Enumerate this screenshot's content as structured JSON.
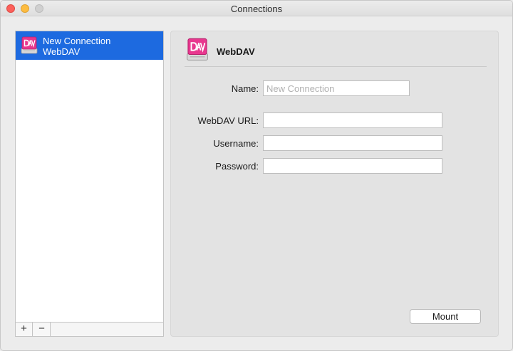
{
  "window": {
    "title": "Connections"
  },
  "sidebar": {
    "items": [
      {
        "name": "New Connection",
        "type": "WebDAV",
        "icon": "webdav-icon",
        "selected": true
      }
    ],
    "footer": {
      "add_label": "+",
      "remove_label": "−"
    }
  },
  "panel": {
    "icon": "webdav-icon",
    "title": "WebDAV",
    "fields": {
      "name": {
        "label": "Name:",
        "value": "",
        "placeholder": "New Connection"
      },
      "url": {
        "label": "WebDAV URL:",
        "value": ""
      },
      "username": {
        "label": "Username:",
        "value": ""
      },
      "password": {
        "label": "Password:",
        "value": ""
      }
    },
    "mount_label": "Mount"
  },
  "colors": {
    "selection": "#1d6ae0",
    "icon_pink": "#e8378e",
    "close": "#fc605b",
    "minimize": "#fdbc40",
    "zoom": "#d0d0d0"
  }
}
